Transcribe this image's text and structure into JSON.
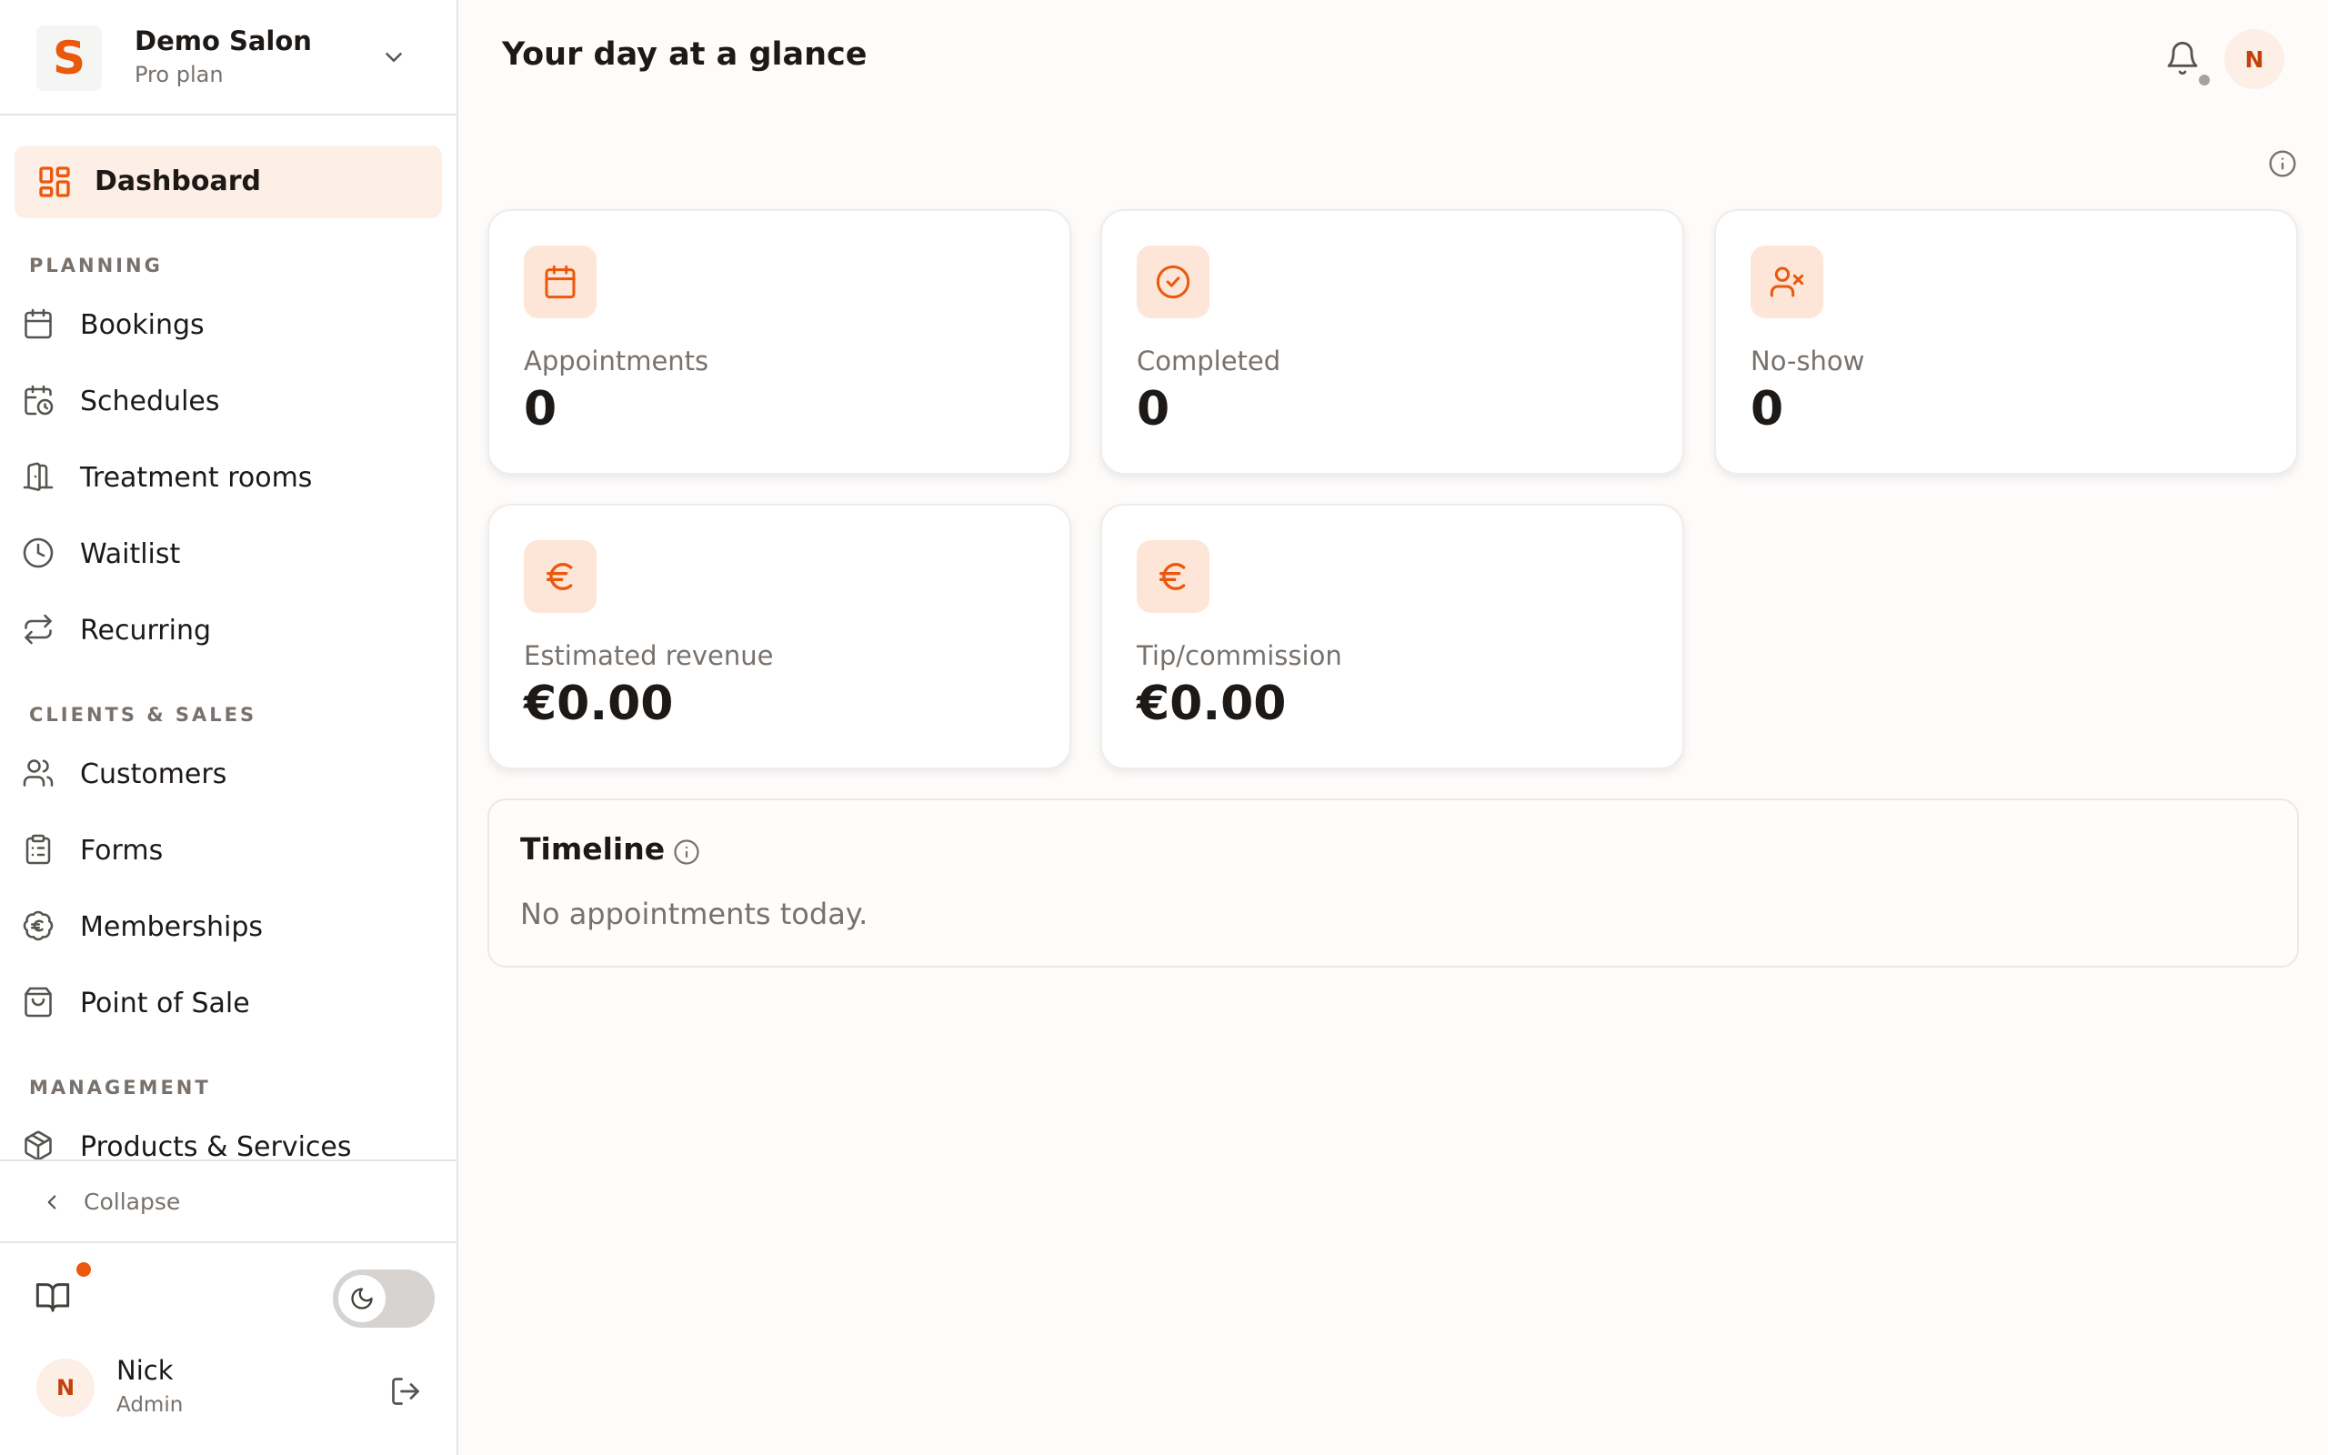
{
  "brand": {
    "logo_letter": "S",
    "name": "Demo Salon",
    "plan": "Pro plan"
  },
  "header": {
    "title": "Your day at a glance",
    "avatar_initial": "N"
  },
  "nav": {
    "dashboard": "Dashboard",
    "sections": [
      {
        "heading": "PLANNING",
        "items": [
          "Bookings",
          "Schedules",
          "Treatment rooms",
          "Waitlist",
          "Recurring"
        ]
      },
      {
        "heading": "CLIENTS & SALES",
        "items": [
          "Customers",
          "Forms",
          "Memberships",
          "Point of Sale"
        ]
      },
      {
        "heading": "MANAGEMENT",
        "items": [
          "Products & Services"
        ]
      }
    ],
    "collapse": "Collapse"
  },
  "stats": [
    {
      "label": "Appointments",
      "value": "0",
      "icon": "calendar-icon"
    },
    {
      "label": "Completed",
      "value": "0",
      "icon": "check-circle-icon"
    },
    {
      "label": "No-show",
      "value": "0",
      "icon": "user-x-icon"
    },
    {
      "label": "Estimated revenue",
      "value": "€0.00",
      "icon": "euro-icon"
    },
    {
      "label": "Tip/commission",
      "value": "€0.00",
      "icon": "euro-icon"
    }
  ],
  "timeline": {
    "title": "Timeline",
    "empty": "No appointments today."
  },
  "user": {
    "initial": "N",
    "name": "Nick",
    "role": "Admin"
  },
  "colors": {
    "accent": "#ea580c",
    "accent_soft": "#fde5d8",
    "active_bg": "#fdeee6"
  }
}
